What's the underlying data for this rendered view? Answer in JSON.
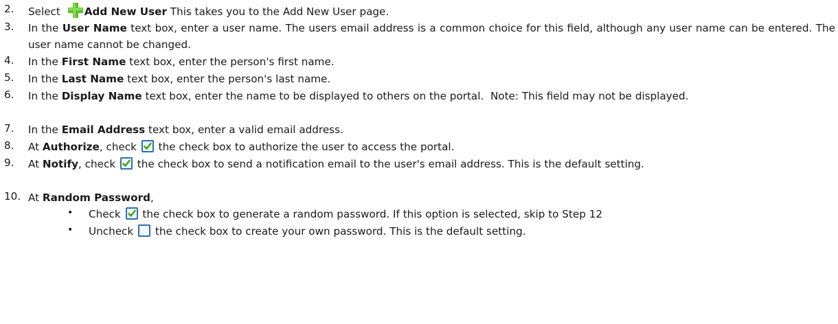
{
  "steps": [
    {
      "number": "2.",
      "pre": "Select ",
      "icon": "green-plus-icon",
      "bold": "Add New User",
      "post": " This takes you to the Add New User page."
    },
    {
      "number": "3.",
      "pre": "In the ",
      "bold": "User Name",
      "post": " text box, enter a user name. The users email address is a common choice for this field, although any user name can be entered. The user name cannot be changed."
    },
    {
      "number": "4.",
      "pre": "In the ",
      "bold": "First Name",
      "post": " text box, enter the person's first name."
    },
    {
      "number": "5.",
      "pre": "In the ",
      "bold": "Last Name",
      "post": " text box, enter the person's last name."
    },
    {
      "number": "6.",
      "pre": "In the ",
      "bold": "Display Name",
      "post": " text box, enter the name to be displayed to others on the portal.  Note: This field may not be displayed."
    },
    {
      "number": "7.",
      "pre": "In the ",
      "bold": "Email Address",
      "post": " text box, enter a valid email address."
    },
    {
      "number": "8.",
      "pre": "At ",
      "bold": "Authorize",
      "mid": ", check ",
      "icon": "checked-checkbox-icon",
      "post": " the check box to authorize the user to access the portal."
    },
    {
      "number": "9.",
      "pre": "At ",
      "bold": "Notify",
      "mid": ", check ",
      "icon": "checked-checkbox-icon",
      "post": " the check box to send a notification email to the user's email address. This is the default setting."
    },
    {
      "number": "10.",
      "pre": "At ",
      "bold": "Random Password",
      "post": ","
    }
  ],
  "bullets": [
    {
      "pre": "Check ",
      "icon": "checked-checkbox-icon",
      "post": " the check box to generate a random password. If this option is selected, skip to Step 12"
    },
    {
      "pre": "Uncheck ",
      "icon": "unchecked-checkbox-icon",
      "post": " the check box to create your own password. This is the default setting."
    }
  ],
  "colors": {
    "plus_icon": "#5bbf2a",
    "checkbox_border": "#2f6fae",
    "checkmark": "#3aa416"
  }
}
